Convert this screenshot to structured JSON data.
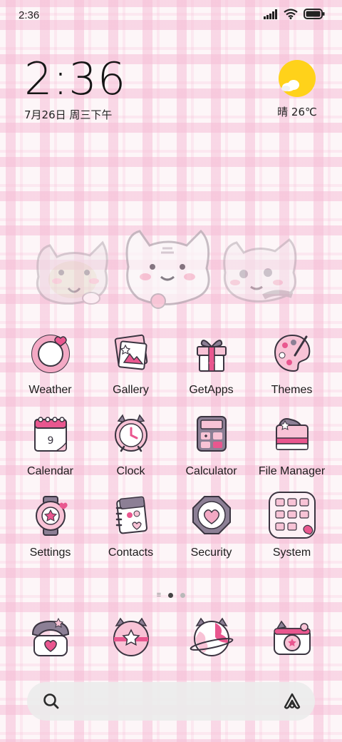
{
  "status_bar": {
    "time": "2:36",
    "icons": [
      "signal-icon",
      "wifi-icon",
      "battery-icon"
    ]
  },
  "clock_widget": {
    "time": "2:36",
    "date": "7月26日 周三下午"
  },
  "weather_widget": {
    "condition_temp": "晴 26℃",
    "icon": "sun-cloud-icon"
  },
  "apps": [
    {
      "label": "Weather",
      "icon": "weather-ring-icon"
    },
    {
      "label": "Gallery",
      "icon": "gallery-photos-icon"
    },
    {
      "label": "GetApps",
      "icon": "gift-box-icon"
    },
    {
      "label": "Themes",
      "icon": "palette-icon"
    },
    {
      "label": "Calendar",
      "icon": "calendar-icon"
    },
    {
      "label": "Clock",
      "icon": "alarm-clock-icon"
    },
    {
      "label": "Calculator",
      "icon": "calculator-icon"
    },
    {
      "label": "File Manager",
      "icon": "shoe-box-icon"
    },
    {
      "label": "Settings",
      "icon": "settings-gear-icon"
    },
    {
      "label": "Contacts",
      "icon": "notebook-icon"
    },
    {
      "label": "Security",
      "icon": "shield-heart-icon"
    },
    {
      "label": "System",
      "icon": "app-folder-icon"
    }
  ],
  "calendar_icon_day": "9",
  "page_indicator": {
    "pages": 2,
    "current": 1
  },
  "dock": [
    {
      "icon": "phone-icon"
    },
    {
      "icon": "messages-bubble-icon"
    },
    {
      "icon": "browser-globe-icon"
    },
    {
      "icon": "camera-icon"
    }
  ],
  "search": {
    "left_icon": "search-icon",
    "right_icon": "assistant-icon"
  },
  "colors": {
    "accent_pink": "#e9578f",
    "light_pink": "#f8c3d6",
    "outline": "#3a3440",
    "grey_purple": "#8c7f95",
    "sun": "#ffd21a"
  }
}
